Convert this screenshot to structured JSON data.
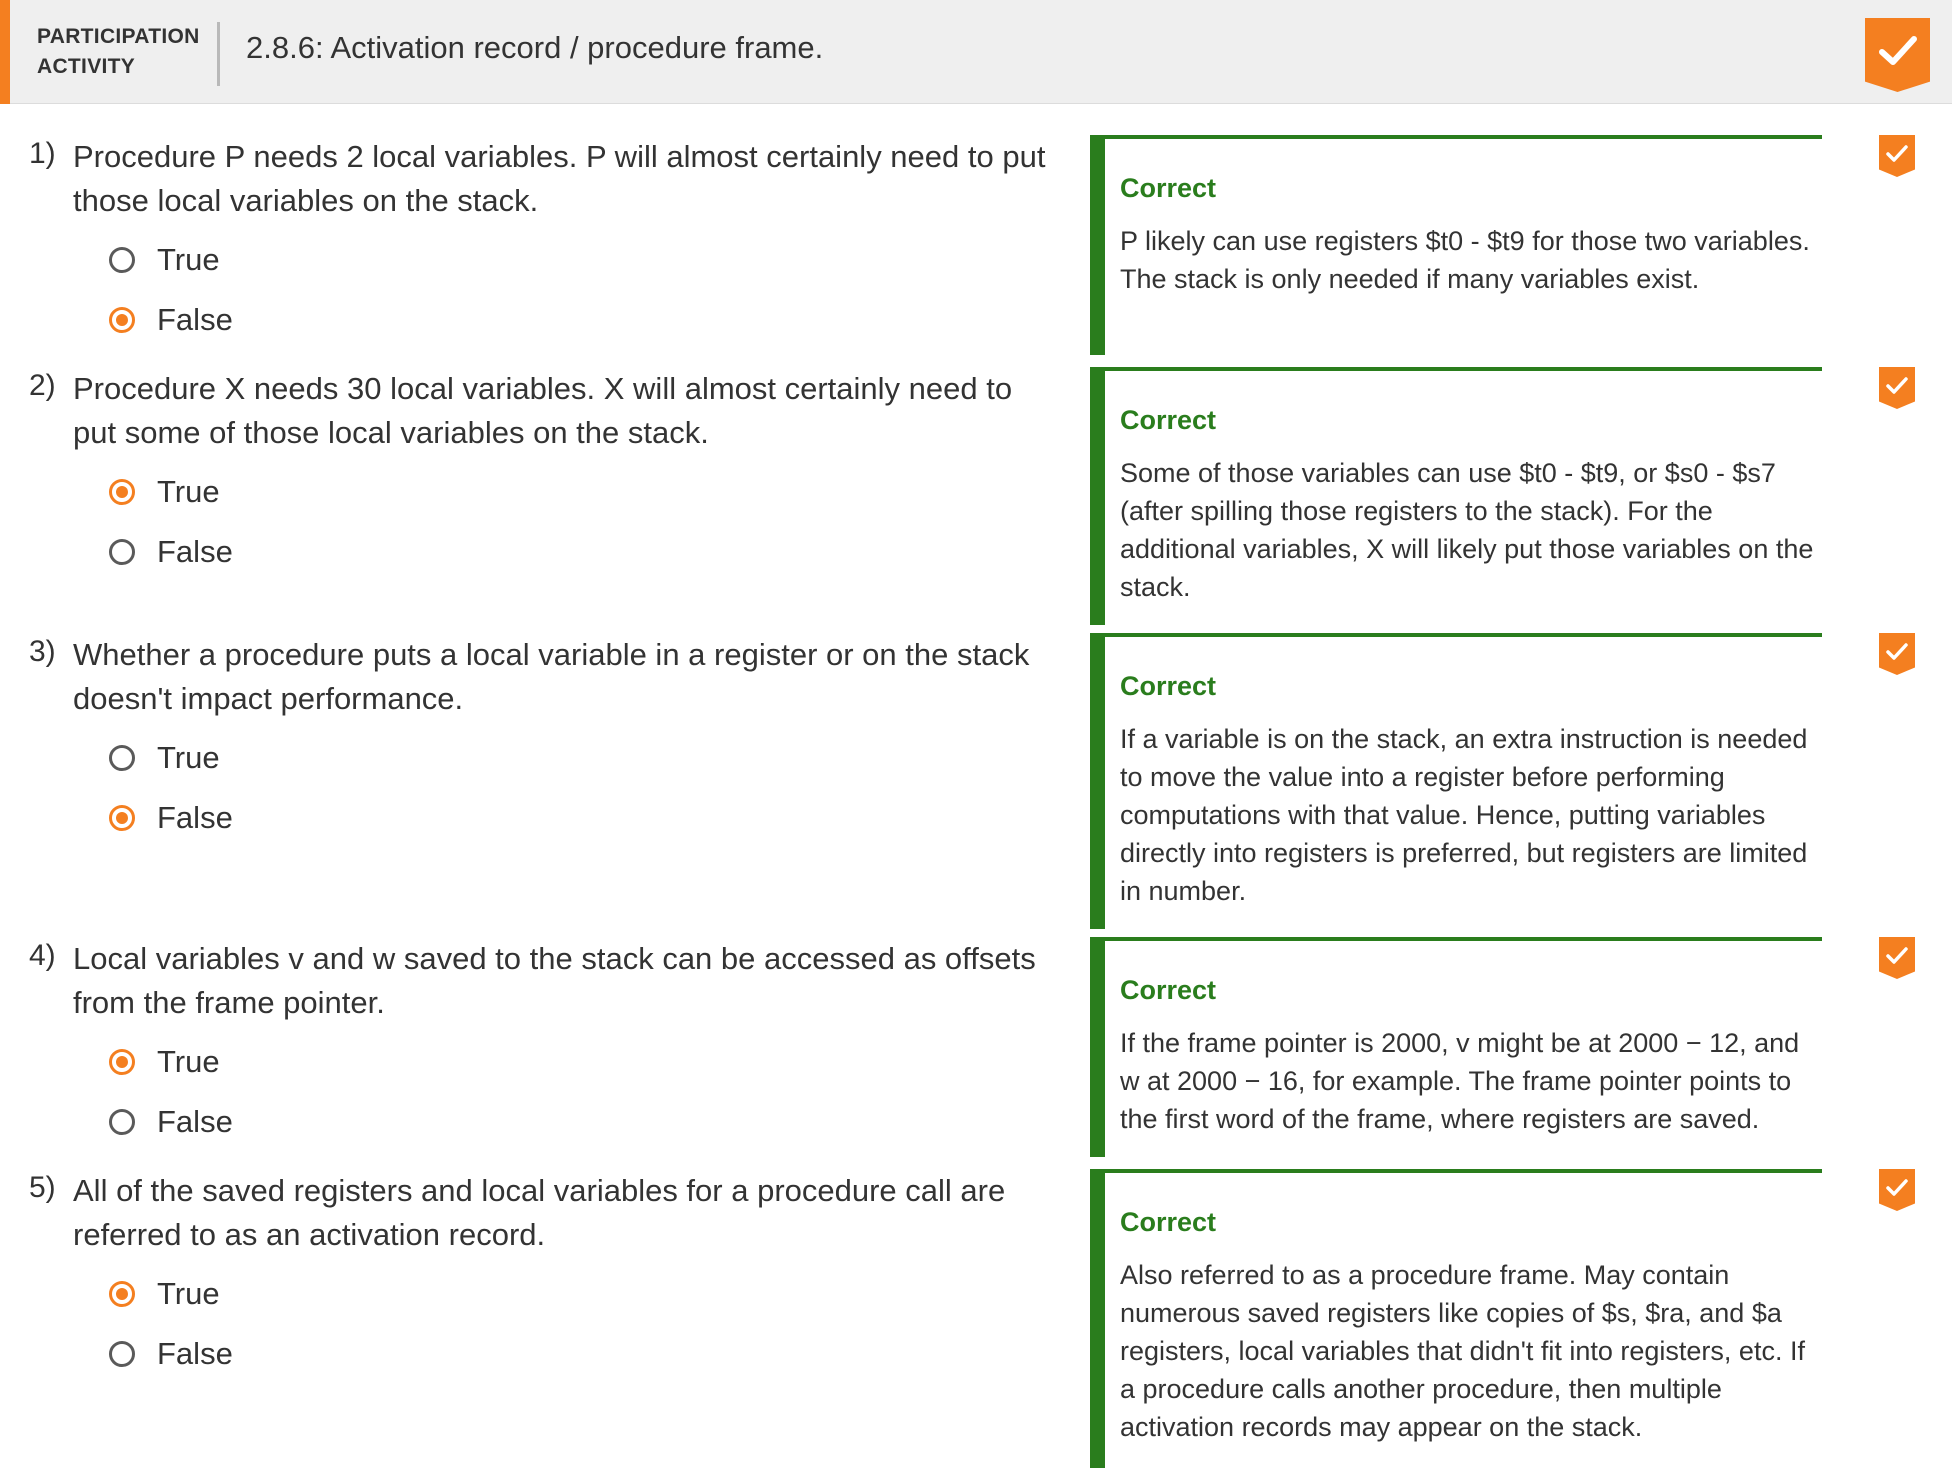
{
  "header": {
    "activity_type": "PARTICIPATION ACTIVITY",
    "title": "2.8.6: Activation record / procedure frame.",
    "completion_icon": "check-badge-icon",
    "accent_color": "#f47f20"
  },
  "feedback_color": "#2a7d1d",
  "questions": [
    {
      "number": "1)",
      "text": "Procedure P needs 2 local variables. P will almost certainly need to put those local variables on the stack.",
      "options": [
        {
          "label": "True",
          "selected": false
        },
        {
          "label": "False",
          "selected": true
        }
      ],
      "feedback_title": "Correct",
      "feedback_text": "P likely can use registers $t0 - $t9 for those two variables. The stack is only needed if many variables exist."
    },
    {
      "number": "2)",
      "text": "Procedure X needs 30 local variables. X will almost certainly need to put some of those local variables on the stack.",
      "options": [
        {
          "label": "True",
          "selected": true
        },
        {
          "label": "False",
          "selected": false
        }
      ],
      "feedback_title": "Correct",
      "feedback_text": "Some of those variables can use $t0 - $t9, or $s0 - $s7 (after spilling those registers to the stack). For the additional variables, X will likely put those variables on the stack."
    },
    {
      "number": "3)",
      "text": "Whether a procedure puts a local variable in a register or on the stack doesn't impact performance.",
      "options": [
        {
          "label": "True",
          "selected": false
        },
        {
          "label": "False",
          "selected": true
        }
      ],
      "feedback_title": "Correct",
      "feedback_text": "If a variable is on the stack, an extra instruction is needed to move the value into a register before performing computations with that value. Hence, putting variables directly into registers is preferred, but registers are limited in number."
    },
    {
      "number": "4)",
      "text": "Local variables v and w saved to the stack can be accessed as offsets from the frame pointer.",
      "options": [
        {
          "label": "True",
          "selected": true
        },
        {
          "label": "False",
          "selected": false
        }
      ],
      "feedback_title": "Correct",
      "feedback_text": "If the frame pointer is 2000, v might be at 2000 − 12, and w at 2000 − 16, for example. The frame pointer points to the first word of the frame, where registers are saved."
    },
    {
      "number": "5)",
      "text": "All of the saved registers and local variables for a procedure call are referred to as an activation record.",
      "options": [
        {
          "label": "True",
          "selected": true
        },
        {
          "label": "False",
          "selected": false
        }
      ],
      "feedback_title": "Correct",
      "feedback_text": "Also referred to as a procedure frame. May contain numerous saved registers like copies of $s, $ra, and $a registers, local variables that didn't fit into registers, etc. If a procedure calls another procedure, then multiple activation records may appear on the stack."
    }
  ]
}
